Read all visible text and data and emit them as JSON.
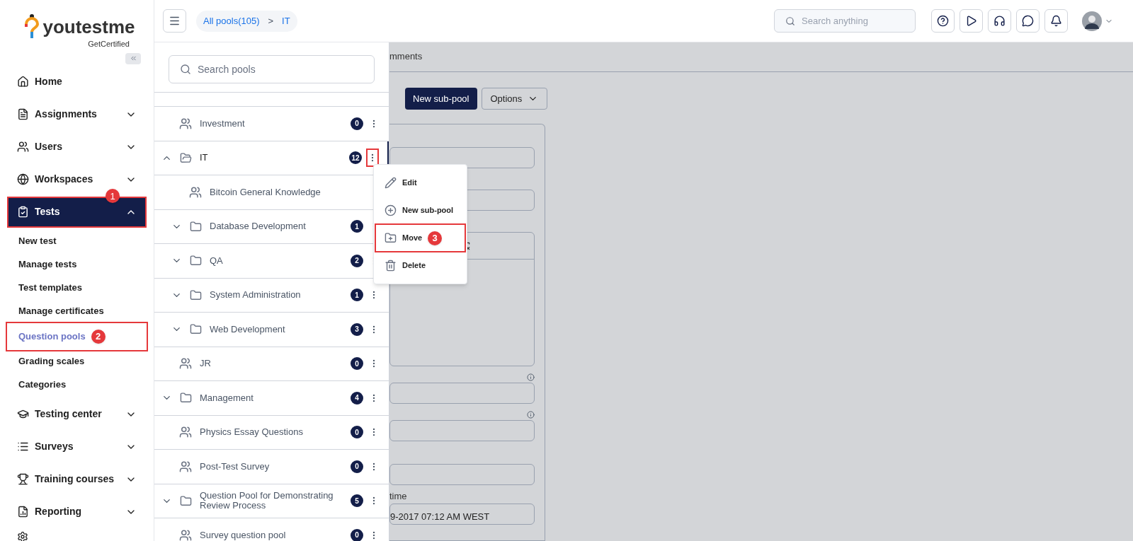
{
  "logo": {
    "name": "youtestme",
    "tagline": "GetCertified"
  },
  "sidebar": {
    "items": [
      {
        "label": "Home",
        "selected": false,
        "highlighted": false
      },
      {
        "label": "Assignments",
        "expandable": true,
        "expanded": false,
        "selected": false,
        "highlighted": false
      },
      {
        "label": "Users",
        "expandable": true,
        "expanded": false,
        "selected": false,
        "highlighted": false
      },
      {
        "label": "Workspaces",
        "expandable": true,
        "expanded": false,
        "selected": false,
        "highlighted": false
      },
      {
        "label": "Tests",
        "expandable": true,
        "expanded": true,
        "selected": true,
        "highlighted": true,
        "step": "1",
        "children": [
          {
            "label": "New test",
            "selected": false,
            "highlighted": false
          },
          {
            "label": "Manage tests",
            "selected": false,
            "highlighted": false
          },
          {
            "label": "Test templates",
            "selected": false,
            "highlighted": false
          },
          {
            "label": "Manage certificates",
            "selected": false,
            "highlighted": false
          },
          {
            "label": "Question pools",
            "selected": true,
            "highlighted": true,
            "step": "2"
          },
          {
            "label": "Grading scales",
            "selected": false,
            "highlighted": false
          },
          {
            "label": "Categories",
            "selected": false,
            "highlighted": false
          }
        ]
      },
      {
        "label": "Testing center",
        "expandable": true,
        "expanded": false,
        "selected": false,
        "highlighted": false
      },
      {
        "label": "Surveys",
        "expandable": true,
        "expanded": false,
        "selected": false,
        "highlighted": false
      },
      {
        "label": "Training courses",
        "expandable": true,
        "expanded": false,
        "selected": false,
        "highlighted": false
      },
      {
        "label": "Reporting",
        "expandable": true,
        "expanded": false,
        "selected": false,
        "highlighted": false
      }
    ]
  },
  "breadcrumb": [
    {
      "label": "All pools(105)"
    },
    {
      "label": "IT"
    }
  ],
  "breadcrumb_separator": ">",
  "search": {
    "placeholder": "Search anything"
  },
  "pools_panel": {
    "search_placeholder": "Search pools",
    "items": [
      {
        "kind": "pool",
        "name": "Investment",
        "count": "0",
        "highlighted": false
      },
      {
        "kind": "folder",
        "name": "IT",
        "count": "12",
        "expanded": true,
        "selected": true,
        "highlighted": true,
        "children": [
          {
            "kind": "pool",
            "name": "Bitcoin General Knowledge"
          },
          {
            "kind": "folder",
            "name": "Database Development",
            "count": "1",
            "expanded": false
          },
          {
            "kind": "folder",
            "name": "QA",
            "count": "2",
            "expanded": false
          },
          {
            "kind": "folder",
            "name": "System Administration",
            "count": "1",
            "expanded": false
          },
          {
            "kind": "folder",
            "name": "Web Development",
            "count": "3",
            "expanded": false
          }
        ]
      },
      {
        "kind": "pool",
        "name": "JR",
        "count": "0",
        "highlighted": false
      },
      {
        "kind": "folder",
        "name": "Management",
        "count": "4",
        "expanded": false,
        "selected": false,
        "highlighted": false
      },
      {
        "kind": "pool",
        "name": "Physics Essay Questions",
        "count": "0",
        "highlighted": false
      },
      {
        "kind": "pool",
        "name": "Post-Test Survey",
        "count": "0",
        "highlighted": false
      },
      {
        "kind": "folder",
        "name": "Question Pool for Demonstrating Review Process",
        "count": "5",
        "expanded": false,
        "selected": false,
        "highlighted": false
      },
      {
        "kind": "pool",
        "name": "Survey question pool",
        "count": "0",
        "highlighted": false
      }
    ]
  },
  "context_menu": {
    "items": [
      {
        "label": "Edit",
        "highlighted": false
      },
      {
        "label": "New sub-pool",
        "highlighted": false
      },
      {
        "label": "Move",
        "highlighted": true,
        "step": "3"
      },
      {
        "label": "Delete",
        "highlighted": false
      }
    ]
  },
  "background": {
    "tab": "mments",
    "primary_button": "New sub-pool",
    "options_button": "Options",
    "field_label": "time",
    "field_value": "9-2017 07:12 AM WEST"
  }
}
